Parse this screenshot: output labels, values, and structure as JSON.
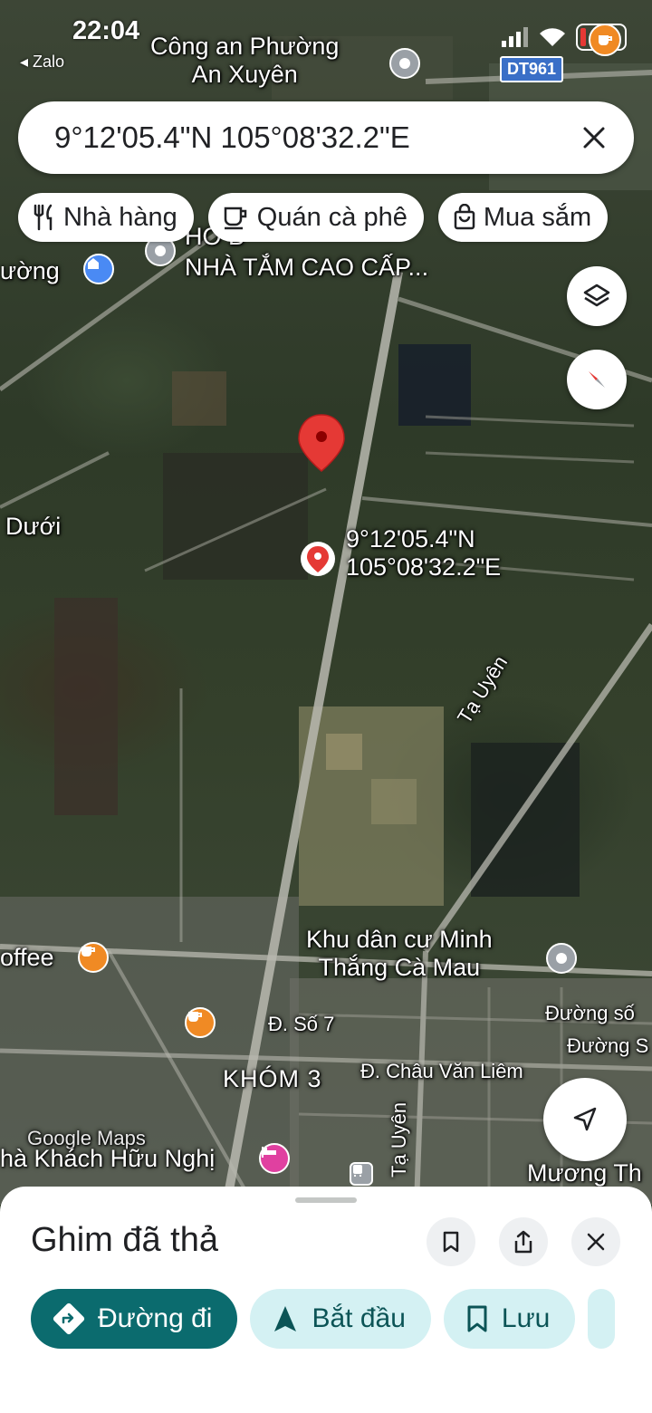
{
  "status_bar": {
    "time": "22:04",
    "back_app": "Zalo",
    "battery": "10"
  },
  "search": {
    "query": "9°12'05.4\"N 105°08'32.2\"E"
  },
  "chips": [
    {
      "label": "Nhà hàng",
      "icon": "restaurant-icon"
    },
    {
      "label": "Quán cà phê",
      "icon": "coffee-icon"
    },
    {
      "label": "Mua sắm",
      "icon": "shopping-bag-icon"
    }
  ],
  "map": {
    "road_badge": "DT961",
    "labels": {
      "cong_an_l1": "Công an Phường",
      "cong_an_l2": "An Xuyên",
      "nha_tam": "NHÀ TẮM CAO CẤP...",
      "nha_tam_partial": "HO                    B",
      "phuong": "ường",
      "duoi": "Dưới",
      "coord_lat": "9°12'05.4\"N",
      "coord_lng": "105°08'32.2\"E",
      "ta_uyen": "Tạ Uyên",
      "khu_dan_cu_l1": "Khu dân cư Minh",
      "khu_dan_cu_l2": "Thắng Cà Mau",
      "coffee": "offee",
      "duong_so_7": "Đ. Số 7",
      "duong_so_a": "Đường số",
      "duong_so_b": "Đường S",
      "khom_3": "KHÓM 3",
      "chau_van_liem": "Đ. Châu Văn Liêm",
      "nha_khach": "hà Khách Hữu Nghị",
      "ta_uyen_2": "Tạ Uyên",
      "muong_th": "Mương Th",
      "watermark": "Google Maps"
    }
  },
  "sheet": {
    "title": "Ghim đã thả",
    "actions": [
      {
        "label": "Đường đi",
        "icon": "directions-icon"
      },
      {
        "label": "Bắt đầu",
        "icon": "navigation-arrow-icon"
      },
      {
        "label": "Lưu",
        "icon": "bookmark-icon"
      }
    ]
  },
  "colors": {
    "primary_action": "#0b6b6e",
    "secondary_action": "#d4f1f3",
    "pin_red": "#e53935"
  }
}
